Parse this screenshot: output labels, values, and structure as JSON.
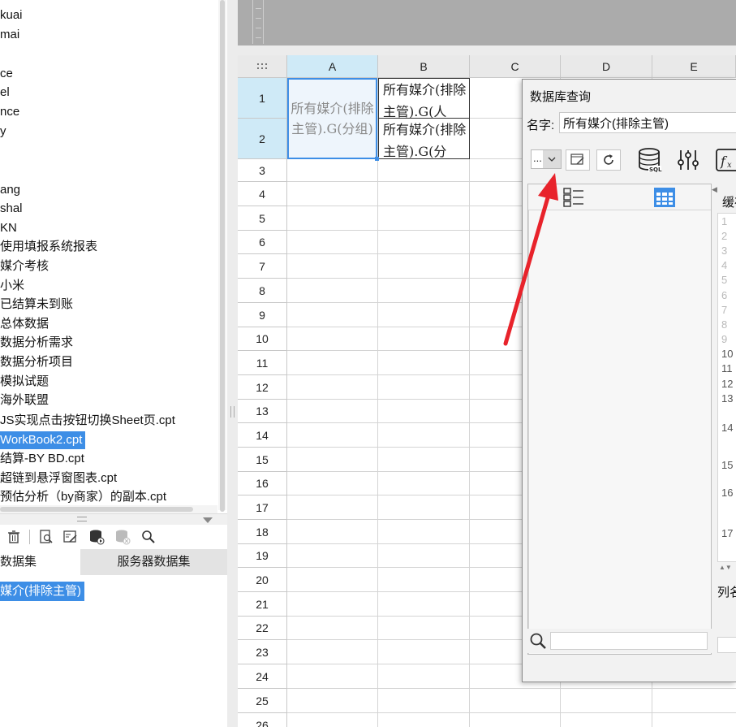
{
  "file_tree": {
    "items": [
      {
        "label": "kuai"
      },
      {
        "label": "mai"
      },
      {
        "label": ""
      },
      {
        "label": "ce"
      },
      {
        "label": "el"
      },
      {
        "label": "nce"
      },
      {
        "label": "y"
      },
      {
        "label": ""
      },
      {
        "label": ""
      },
      {
        "label": "ang"
      },
      {
        "label": "shal"
      },
      {
        "label": "KN"
      },
      {
        "label": "使用填报系统报表"
      },
      {
        "label": "媒介考核"
      },
      {
        "label": "小米"
      },
      {
        "label": "已结算未到账"
      },
      {
        "label": "总体数据"
      },
      {
        "label": "数据分析需求"
      },
      {
        "label": "数据分析项目"
      },
      {
        "label": "模拟试题"
      },
      {
        "label": "海外联盟"
      },
      {
        "label": "JS实现点击按钮切换Sheet页.cpt"
      },
      {
        "label": "WorkBook2.cpt",
        "selected": true
      },
      {
        "label": "结算-BY BD.cpt"
      },
      {
        "label": "超链到悬浮窗图表.cpt"
      },
      {
        "label": "预估分析（by商家）的副本.cpt"
      }
    ]
  },
  "dataset_panel": {
    "tab_template": "数据集",
    "tab_server": "服务器数据集",
    "selected_dataset": "媒介(排除主管)",
    "toolbar_icons": [
      "trash-icon",
      "preview-icon",
      "edit-dataset-icon",
      "db-run-icon",
      "db-remove-icon",
      "search-icon"
    ]
  },
  "sheet": {
    "columns": [
      "A",
      "B",
      "C",
      "D",
      "E"
    ],
    "rows": [
      "1",
      "2",
      "3",
      "4",
      "5",
      "6",
      "7",
      "8",
      "9",
      "10",
      "11",
      "12",
      "13",
      "14",
      "15",
      "16",
      "17",
      "18",
      "19",
      "20",
      "21",
      "22",
      "23",
      "24",
      "25",
      "26"
    ],
    "cell_a1": "所有媒介(排除主管).G(分组)",
    "cell_b1": "所有媒介(排除主管).G(人",
    "cell_b2": "所有媒介(排除主管).G(分"
  },
  "dialog": {
    "title": "数据库查询",
    "name_label": "名字:",
    "name_value": "所有媒介(排除主管)",
    "connection_value": "...",
    "cache_label": "缓存",
    "column_label": "列名",
    "line_numbers": [
      "1",
      "2",
      "3",
      "4",
      "5",
      "6",
      "7",
      "8",
      "9",
      "10",
      "11",
      "12",
      "13",
      "14",
      "15",
      "16",
      "17"
    ]
  },
  "colors": {
    "accent": "#3d8ee6",
    "arrow": "#e8232b",
    "header_active": "#cfeaf7"
  }
}
